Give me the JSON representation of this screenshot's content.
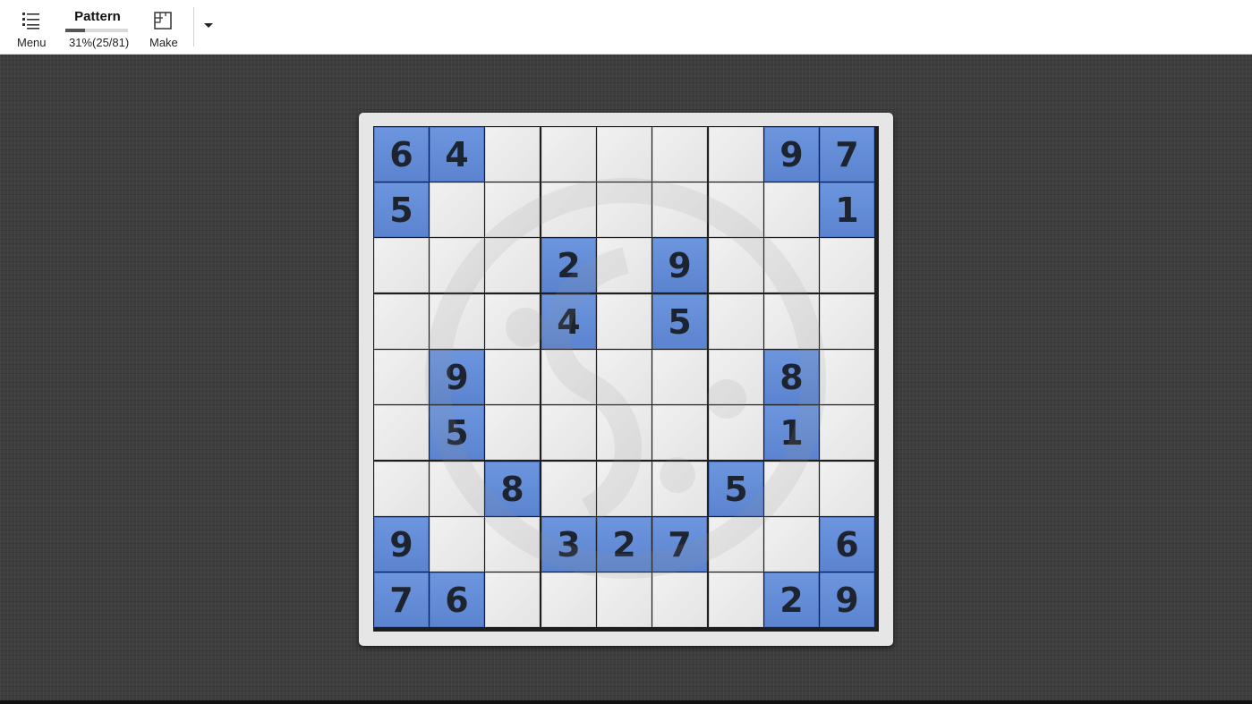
{
  "toolbar": {
    "menu_label": "Menu",
    "menu_icon": "list-icon",
    "puzzle_title": "Pattern",
    "progress_text": "31%(25/81)",
    "progress_fraction": 0.31,
    "make_label": "Make",
    "make_icon": "grid-edit-icon",
    "dropdown_icon": "caret-down-icon"
  },
  "colors": {
    "given_cell": "#5f89d6",
    "empty_cell": "#ececec",
    "background": "#3d3d3d",
    "digit": "#1d2430"
  },
  "board": {
    "size": 9,
    "rows": [
      [
        "6",
        "4",
        "",
        "",
        "",
        "",
        "",
        "9",
        "7"
      ],
      [
        "5",
        "",
        "",
        "",
        "",
        "",
        "",
        "",
        "1"
      ],
      [
        "",
        "",
        "",
        "2",
        "",
        "9",
        "",
        "",
        ""
      ],
      [
        "",
        "",
        "",
        "4",
        "",
        "5",
        "",
        "",
        ""
      ],
      [
        "",
        "9",
        "",
        "",
        "",
        "",
        "",
        "8",
        ""
      ],
      [
        "",
        "5",
        "",
        "",
        "",
        "",
        "",
        "1",
        ""
      ],
      [
        "",
        "",
        "8",
        "",
        "",
        "",
        "5",
        "",
        ""
      ],
      [
        "9",
        "",
        "",
        "3",
        "2",
        "7",
        "",
        "",
        "6"
      ],
      [
        "7",
        "6",
        "",
        "",
        "",
        "",
        "",
        "2",
        "9"
      ]
    ]
  }
}
